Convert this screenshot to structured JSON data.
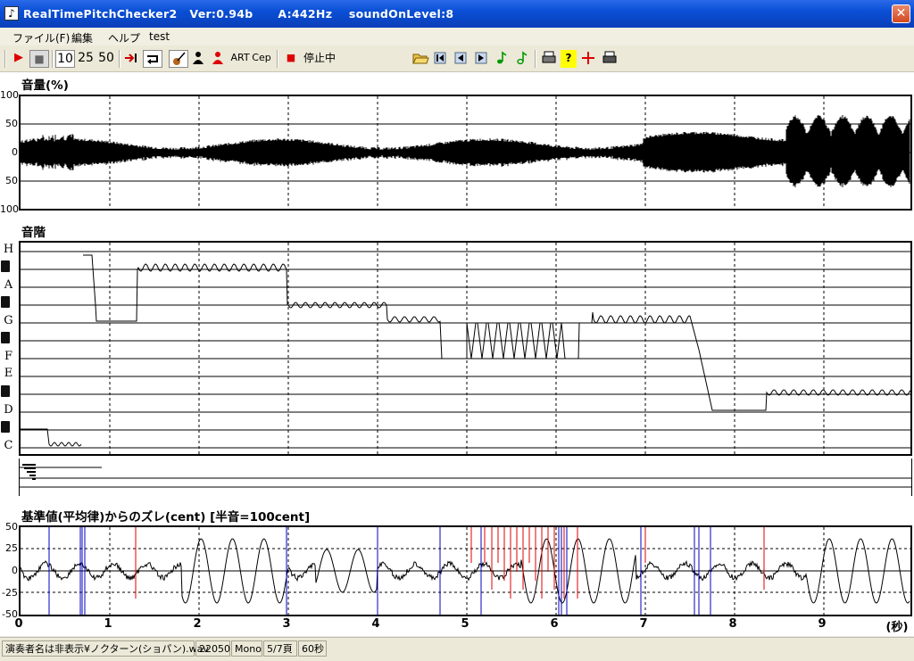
{
  "window": {
    "title": "RealTimePitchChecker2   Ver:0.94b      A:442Hz    soundOnLevel:8",
    "app_icon": "violin-icon",
    "close_label": "✕"
  },
  "menu": [
    "ファイル(F)",
    "編集",
    "ヘルプ",
    "test"
  ],
  "toolbar": {
    "play_icon": "▶",
    "stop_icon": "■",
    "speed_10": "10",
    "speed_25": "25",
    "speed_50": "50",
    "art_label": "ART",
    "cep_label": "Cep",
    "record_icon": "■",
    "state_label": "停止中",
    "status_field": "＊＊＊"
  },
  "volume_panel": {
    "title": "音量(%)",
    "yticks": [
      "100",
      "50",
      "0",
      "50",
      "100"
    ]
  },
  "scale_panel": {
    "title": "音階",
    "notes": [
      "H",
      "A",
      "G",
      "F",
      "E",
      "D",
      "C"
    ]
  },
  "cent_panel": {
    "title": "基準値(平均律)からのズレ(cent) [半音=100cent]",
    "yticks": [
      "50",
      "25",
      "0",
      "-25",
      "-50"
    ]
  },
  "x_axis": {
    "ticks": [
      "0",
      "1",
      "2",
      "3",
      "4",
      "5",
      "6",
      "7",
      "8",
      "9"
    ],
    "unit": "(秒)"
  },
  "statusbar": {
    "file": "演奏者名は非表示¥ノクターン(ショパン).wav",
    "rate": "22050",
    "channels": "Mono",
    "page": "5/7頁",
    "duration": "60秒"
  },
  "colors": {
    "titlebar": "#0a4fd6",
    "trace": "#000000",
    "red_marker": "#e00000",
    "blue_marker": "#0000c0"
  }
}
